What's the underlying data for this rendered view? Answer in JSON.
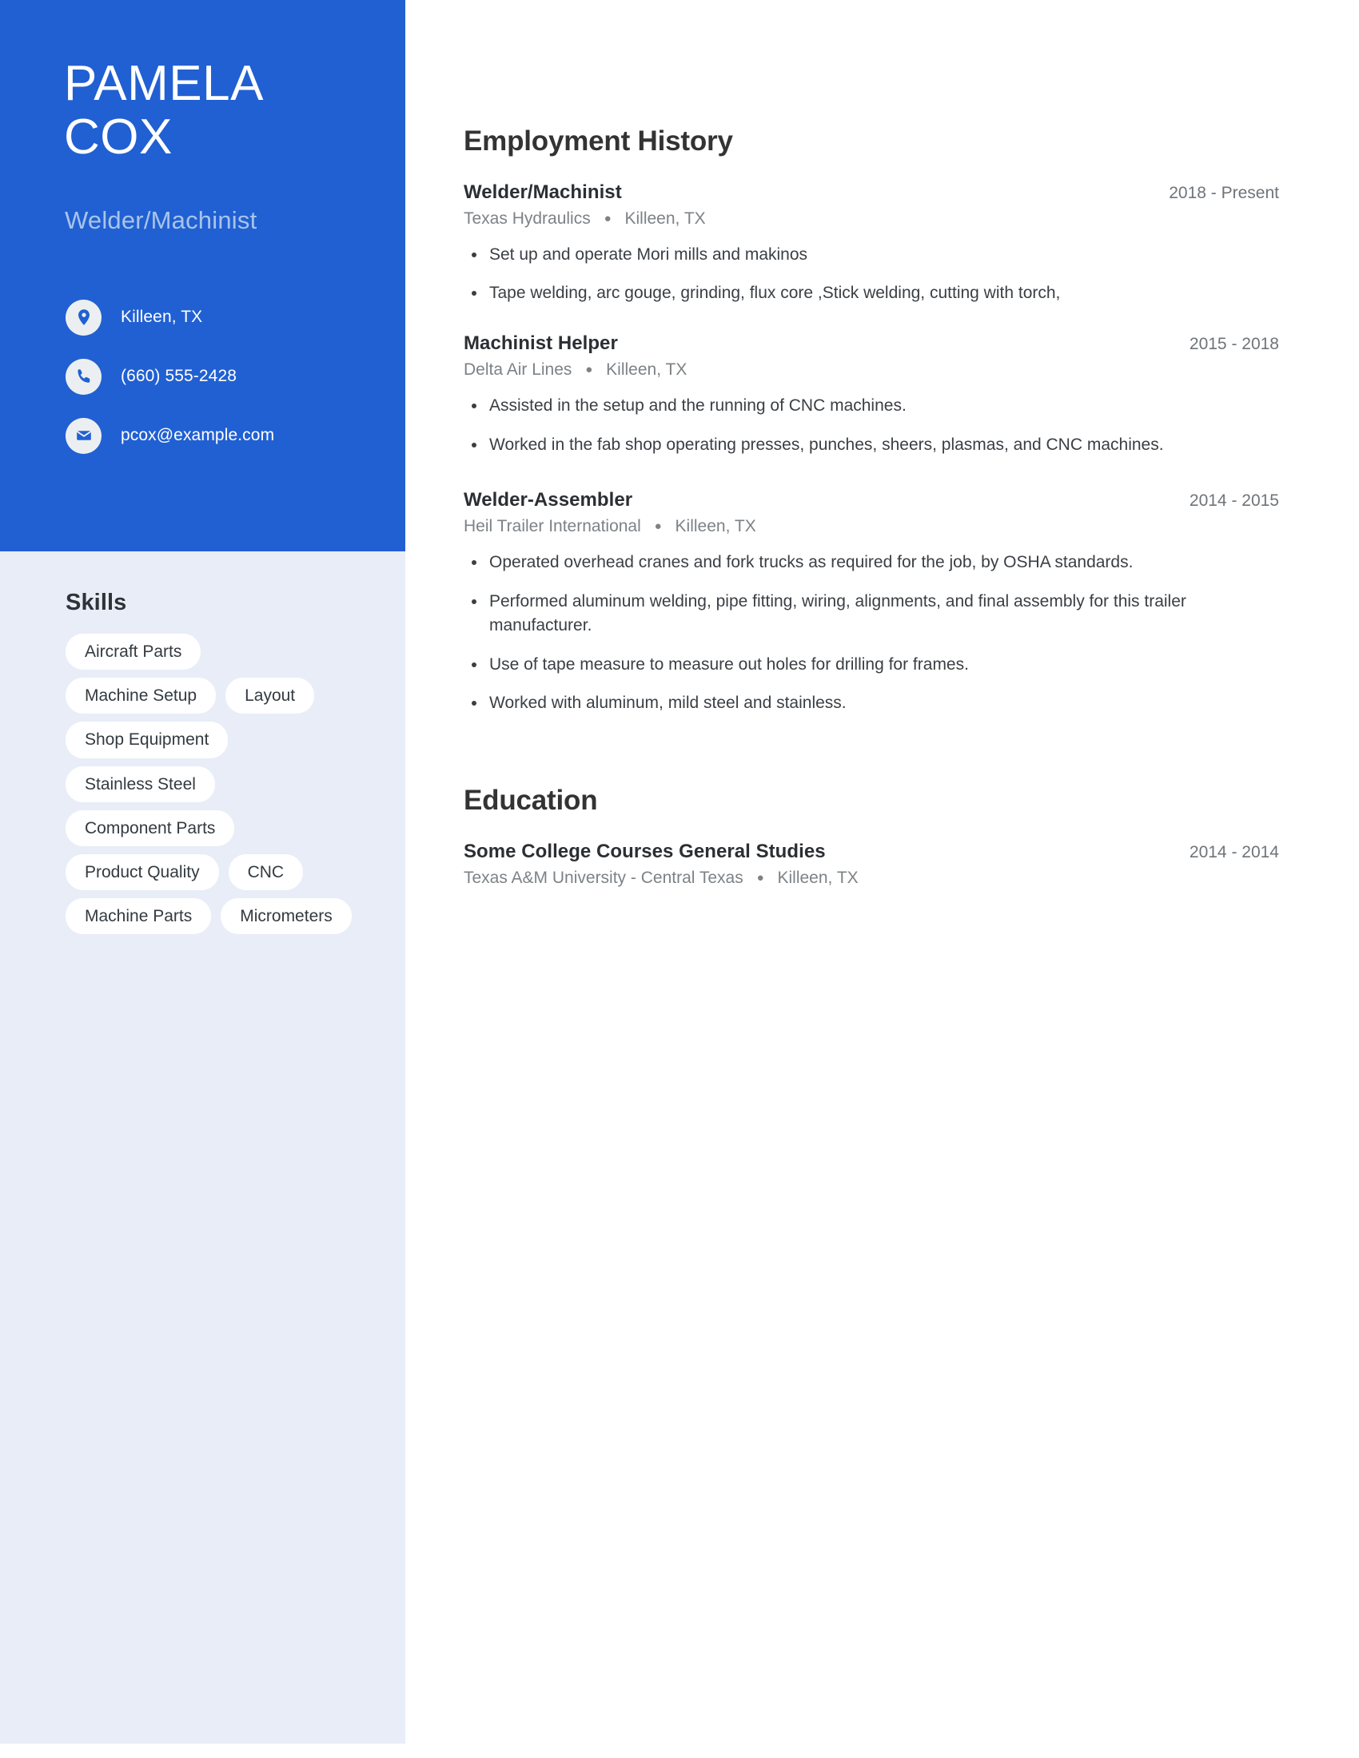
{
  "sidebar": {
    "name_lines": [
      "PAMELA",
      "COX"
    ],
    "job_title": "Welder/Machinist",
    "contacts": [
      {
        "icon": "location-pin-icon",
        "text": "Killeen, TX"
      },
      {
        "icon": "phone-icon",
        "text": "(660) 555-2428"
      },
      {
        "icon": "envelope-icon",
        "text": "pcox@example.com"
      }
    ],
    "skills_heading": "Skills",
    "skills": [
      "Aircraft Parts",
      "Machine Setup",
      "Layout",
      "Shop Equipment",
      "Stainless Steel",
      "Component Parts",
      "Product Quality",
      "CNC",
      "Machine Parts",
      "Micrometers"
    ]
  },
  "main": {
    "employment": {
      "title": "Employment History",
      "entries": [
        {
          "role": "Welder/Machinist",
          "dates": "2018 - Present",
          "company": "Texas Hydraulics",
          "location": "Killeen, TX",
          "bullets": [
            "Set up and operate Mori mills and makinos",
            "Tape welding, arc gouge, grinding, flux core ,Stick welding, cutting with torch,"
          ]
        },
        {
          "role": "Machinist Helper",
          "dates": "2015 - 2018",
          "company": "Delta Air Lines",
          "location": "Killeen, TX",
          "bullets": [
            "Assisted in the setup and the running of CNC machines.",
            "Worked in the fab shop operating presses, punches, sheers, plasmas, and CNC machines."
          ]
        },
        {
          "role": "Welder-Assembler",
          "dates": "2014 - 2015",
          "company": "Heil Trailer International",
          "location": "Killeen, TX",
          "bullets": [
            "Operated overhead cranes and fork trucks as required for the job, by OSHA standards.",
            "Performed aluminum welding, pipe fitting, wiring, alignments, and final assembly for this trailer manufacturer.",
            "Use of tape measure to measure out holes for drilling for frames.",
            "Worked with aluminum, mild steel and stainless."
          ]
        }
      ]
    },
    "education": {
      "title": "Education",
      "entries": [
        {
          "degree": "Some College Courses General Studies",
          "dates": "2014 - 2014",
          "school": "Texas A&M University - Central Texas",
          "location": "Killeen, TX"
        }
      ]
    }
  },
  "colors": {
    "accent_blue": "#2160d2",
    "sidebar_panel": "#e8edf8",
    "subtitle_blue": "#a8c4ea",
    "heading_dark": "#333333",
    "body_text": "#3a3f44",
    "muted_text": "#7c8286",
    "tag_background": "#ffffff"
  }
}
